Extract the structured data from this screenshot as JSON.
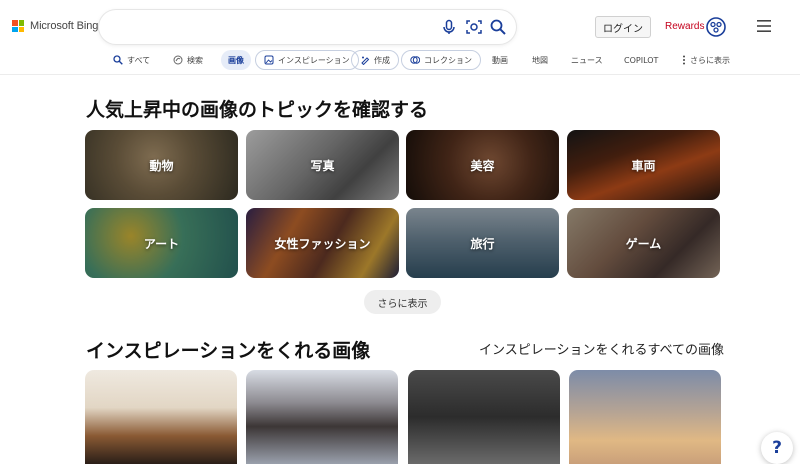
{
  "header": {
    "brand": "Microsoft Bing",
    "search_value": "",
    "login_label": "ログイン",
    "rewards_label": "Rewards"
  },
  "nav": {
    "items": [
      {
        "label": "すべて",
        "icon": "search-icon"
      },
      {
        "label": "検索",
        "icon": "copilot-search-icon"
      },
      {
        "label": "画像",
        "active": true
      },
      {
        "label": "インスピレーション",
        "icon": "inspiration-icon"
      },
      {
        "label": "作成",
        "icon": "create-icon"
      },
      {
        "label": "コレクション",
        "icon": "collection-icon"
      },
      {
        "label": "動画"
      },
      {
        "label": "地図"
      },
      {
        "label": "ニュース"
      },
      {
        "label": "COPILOT"
      },
      {
        "label": "さらに表示",
        "icon": "more-vertical-icon"
      }
    ]
  },
  "topics": {
    "title": "人気上昇中の画像のトピックを確認する",
    "tiles": [
      {
        "label": "動物"
      },
      {
        "label": "写真"
      },
      {
        "label": "美容"
      },
      {
        "label": "車両"
      },
      {
        "label": "アート"
      },
      {
        "label": "女性ファッション"
      },
      {
        "label": "旅行"
      },
      {
        "label": "ゲーム"
      }
    ],
    "more_label": "さらに表示"
  },
  "inspiration": {
    "title": "インスピレーションをくれる画像",
    "link_label": "インスピレーションをくれるすべての画像"
  },
  "help": {
    "label": "?"
  },
  "colors": {
    "accent": "#1a3e9a",
    "rewards": "#c4001c",
    "active_pill_bg": "#e6ecf8"
  }
}
